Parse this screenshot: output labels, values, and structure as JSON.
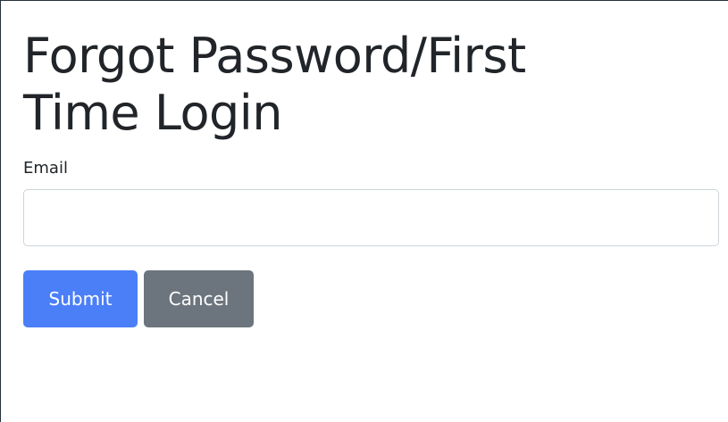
{
  "page": {
    "title_line1": "Forgot Password/First",
    "title_line2": "Time Login"
  },
  "form": {
    "email_label": "Email",
    "email_value": "",
    "email_placeholder": ""
  },
  "buttons": {
    "submit_label": "Submit",
    "cancel_label": "Cancel"
  },
  "colors": {
    "primary": "#4b7ff8",
    "secondary": "#6c757d",
    "text": "#212529",
    "input_border": "#ced4da"
  }
}
